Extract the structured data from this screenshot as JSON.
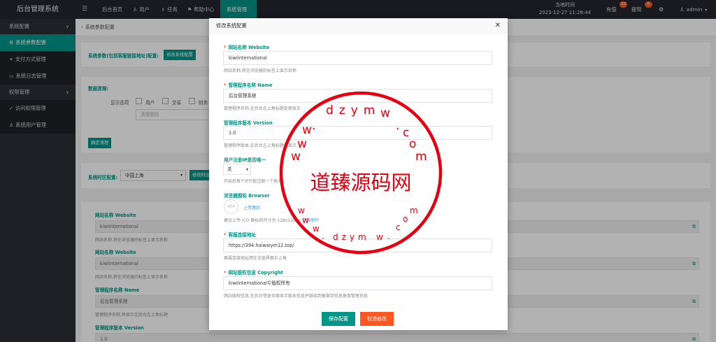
{
  "topbar": {
    "logo": "后台管理系统",
    "nav": [
      {
        "label": "后台首页"
      },
      {
        "label": "用户"
      },
      {
        "label": "任务"
      },
      {
        "label": "帮助中心"
      },
      {
        "label": "系统管理"
      }
    ],
    "time_label": "当地时间",
    "time_value": "2023-12-27 11:28:44",
    "recharge": {
      "label": "充值",
      "count": "32"
    },
    "withdraw": {
      "label": "提现",
      "count": "0"
    },
    "user": "admin"
  },
  "sidebar": {
    "groups": [
      {
        "label": "系统配置",
        "items": [
          {
            "label": "系统参数配置"
          },
          {
            "label": "支付方式管理"
          },
          {
            "label": "系统日志管理"
          }
        ]
      },
      {
        "label": "权限管理",
        "items": [
          {
            "label": "访问权限管理"
          },
          {
            "label": "系统用户管理"
          }
        ]
      }
    ]
  },
  "main": {
    "breadcrumb": "系统参数配置",
    "params_label": "系统参数(包括客服链接地址)配置:",
    "params_button": "修改系统配置",
    "data_clean_label": "数据清理:",
    "display_label": "显示选项",
    "options": [
      "用户",
      "交易",
      "财务"
    ],
    "clean_placeholder": "清理密码",
    "clean_button": "确定清理",
    "timezone_label": "系统时区配置:",
    "timezone_value": "中国上海",
    "timezone_button": "修改时区",
    "fields": [
      {
        "label": "网站名称 Website",
        "value": "kiwiinternational",
        "hint": "网站名称,将在浏览器的标签上显示名称"
      },
      {
        "label": "网站名称 Website",
        "value": "kiwiinternational",
        "hint": "网站名称,将在浏览器的标签上显示名称"
      },
      {
        "label": "管理程序名称 Name",
        "value": "后台管理系统",
        "hint": "管理程序名称,将显示在后台左上角标题"
      },
      {
        "label": "管理程序版本 Version",
        "value": "1.0"
      }
    ]
  },
  "modal": {
    "title": "修改系统配置",
    "website_label": "网站名称 Website",
    "website_value": "kiwiinternational",
    "website_hint": "网站名称,将在浏览器的标签上显示名称",
    "name_label": "管理程序名称 Name",
    "name_value": "后台管理系统",
    "name_hint": "管理程序名称,在后台左上角标题处理显示",
    "version_label": "管理程序版本 Version",
    "version_value": "1.0",
    "version_hint": "管理程序版本,在后台左上角标题处显示",
    "ip_label": "用户注册IP是否唯一",
    "ip_value": "关",
    "ip_hint": "开启后每个IP只能注册一个账号",
    "browser_label": "浏览器图标 Browser",
    "favicon_text": "404",
    "upload_label": "上传图片",
    "browser_hint": "建议上传 ICO 图标的尺寸为 128x128px",
    "browser_hint_link": "在线制作",
    "service_label": "客服连接地址",
    "service_value": "https://394.haiwaiym12.top/",
    "service_hint": "客服连接地址用在充值界面右上角",
    "copyright_label": "网站版权信息 Copyright",
    "copyright_value": "kiwiinternational©版权所有",
    "copyright_hint": "网站版权信息,在后台登录页面显示版本信息并链接到备案到信息备案管理系统",
    "save_button": "保存配置",
    "cancel_button": "取消修改"
  },
  "stamp": {
    "center_text": "道臻源码网",
    "ring_top": "dzym",
    "ring_bottom": "dzym",
    "ring_char_w": "w",
    "ring_char_c": "c",
    "ring_char_o": "o",
    "ring_char_m": "m",
    "ring_dot": ".",
    "color": "#e60012"
  },
  "colors": {
    "accent": "#009688",
    "danger": "#ff5722",
    "topbar": "#23262e",
    "sidebar": "#2b2e37"
  }
}
